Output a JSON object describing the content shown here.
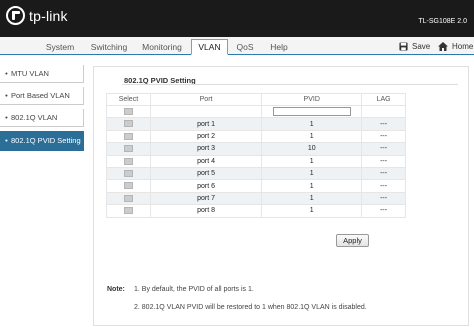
{
  "header": {
    "logo_text": "tp-link",
    "model": "TL-SG108E 2.0"
  },
  "nav": {
    "tabs": [
      {
        "label": "System"
      },
      {
        "label": "Switching"
      },
      {
        "label": "Monitoring"
      },
      {
        "label": "VLAN",
        "active": true
      },
      {
        "label": "QoS"
      },
      {
        "label": "Help"
      }
    ],
    "save_label": "Save",
    "home_label": "Home"
  },
  "sidebar": {
    "items": [
      {
        "label": "MTU VLAN"
      },
      {
        "label": "Port Based VLAN"
      },
      {
        "label": "802.1Q VLAN"
      },
      {
        "label": "802.1Q PVID Setting",
        "active": true
      }
    ]
  },
  "panel": {
    "title": "802.1Q PVID Setting",
    "columns": [
      "Select",
      "Port",
      "PVID",
      "LAG"
    ],
    "input_value": "",
    "rows": [
      {
        "port": "port 1",
        "pvid": "1",
        "lag": "---"
      },
      {
        "port": "port 2",
        "pvid": "1",
        "lag": "---"
      },
      {
        "port": "port 3",
        "pvid": "10",
        "lag": "---"
      },
      {
        "port": "port 4",
        "pvid": "1",
        "lag": "---"
      },
      {
        "port": "port 5",
        "pvid": "1",
        "lag": "---"
      },
      {
        "port": "port 6",
        "pvid": "1",
        "lag": "---"
      },
      {
        "port": "port 7",
        "pvid": "1",
        "lag": "---"
      },
      {
        "port": "port 8",
        "pvid": "1",
        "lag": "---"
      }
    ],
    "apply_label": "Apply"
  },
  "notes": {
    "label": "Note:",
    "items": [
      "1. By default, the PVID of all ports is 1.",
      "2. 802.1Q VLAN PVID will be restored to 1 when 802.1Q VLAN is disabled."
    ]
  },
  "colors": {
    "header_bg": "#1a1a1a",
    "accent": "#2b6f99"
  }
}
